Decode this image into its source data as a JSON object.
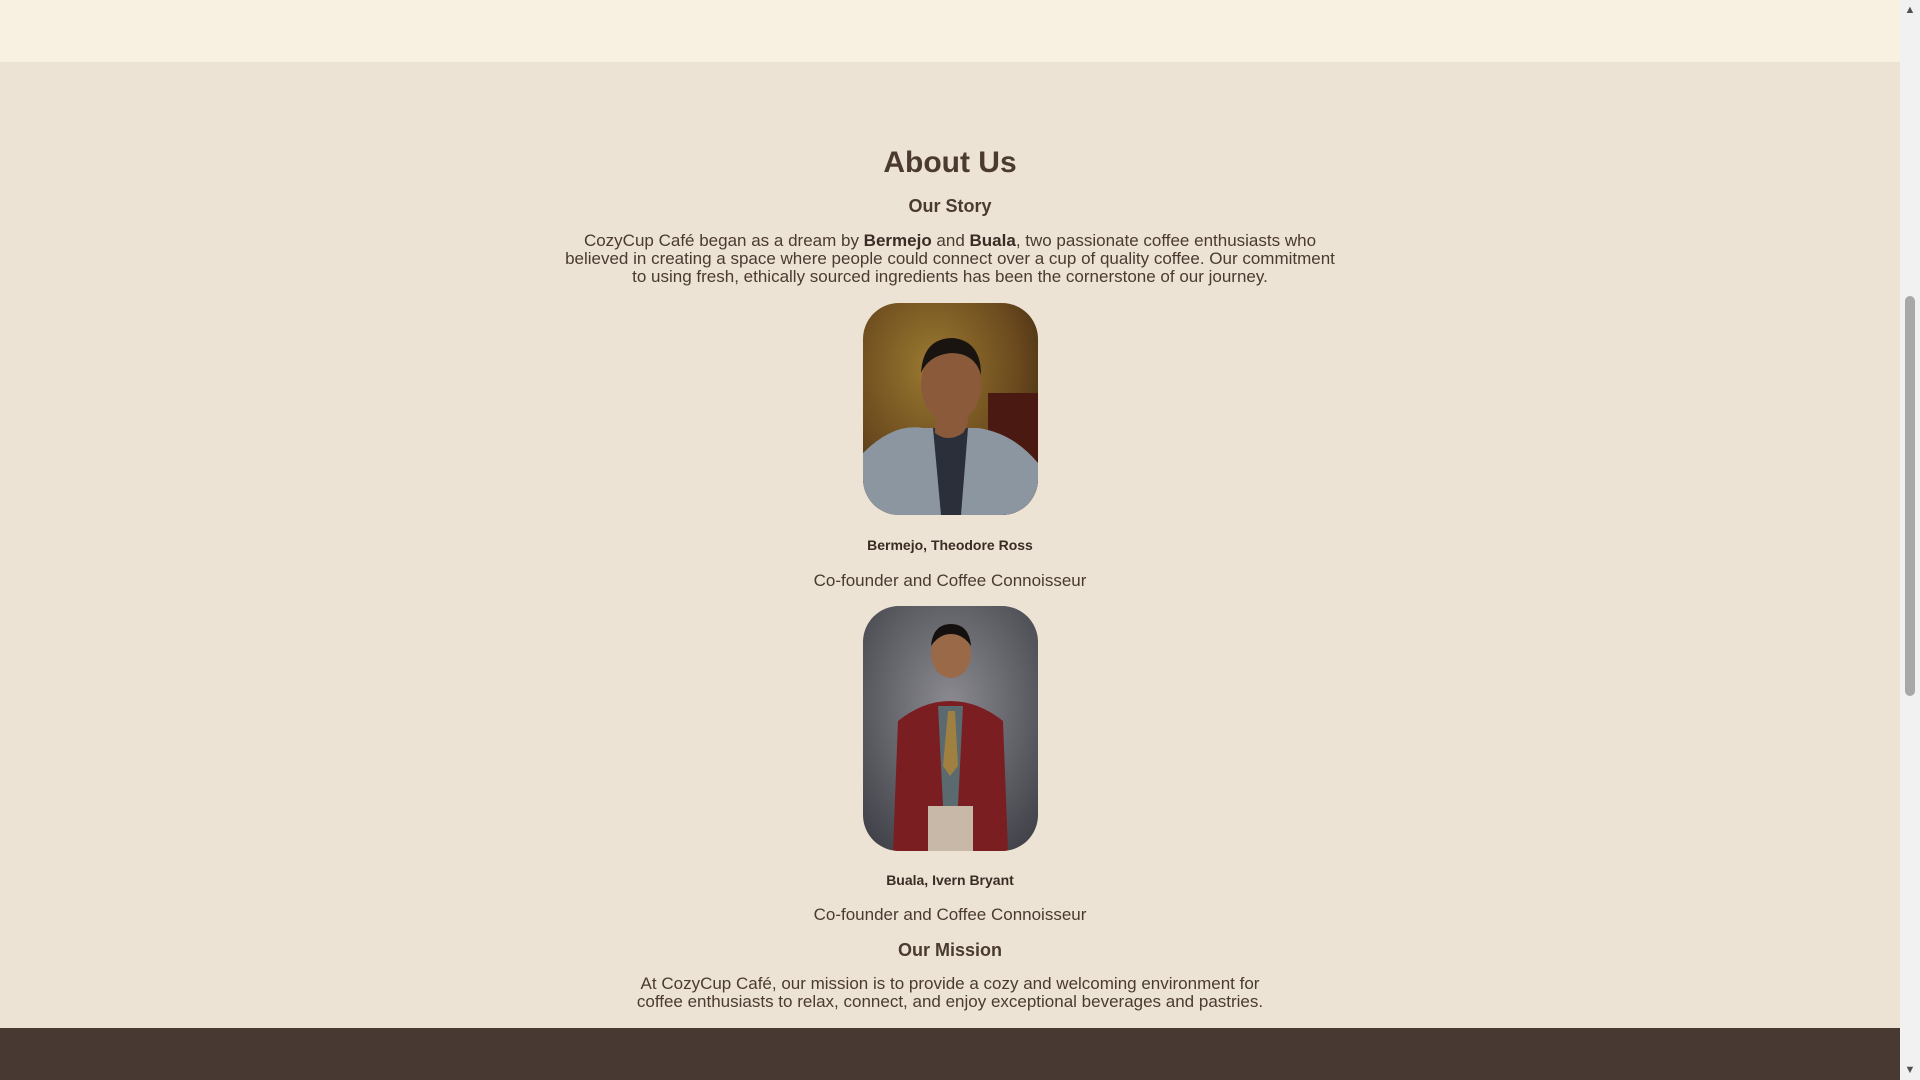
{
  "about": {
    "title": "About Us",
    "story_heading": "Our Story",
    "story_text": {
      "part1": "CozyCup Café began as a dream by ",
      "name1": "Bermejo",
      "part2": " and ",
      "name2": "Buala",
      "part3": ", two passionate coffee enthusiasts who believed in creating a space where people could connect over a cup of quality coffee. Our commitment to using fresh, ethically sourced ingredients has been the cornerstone of our journey."
    },
    "founders": [
      {
        "name": "Bermejo, Theodore Ross",
        "role": "Co-founder and Coffee Connoisseur"
      },
      {
        "name": "Buala, Ivern Bryant",
        "role": "Co-founder and Coffee Connoisseur"
      }
    ],
    "mission_heading": "Our Mission",
    "mission_text": "At CozyCup Café, our mission is to provide a cozy and welcoming environment for coffee enthusiasts to relax, connect, and enjoy exceptional beverages and pastries."
  },
  "colors": {
    "page_bg": "#ede3d5",
    "header_band": "#f8f0e0",
    "footer": "#483a32",
    "text": "#4a3a30"
  },
  "icons": {
    "scroll_up": "▲",
    "scroll_down": "▼"
  }
}
